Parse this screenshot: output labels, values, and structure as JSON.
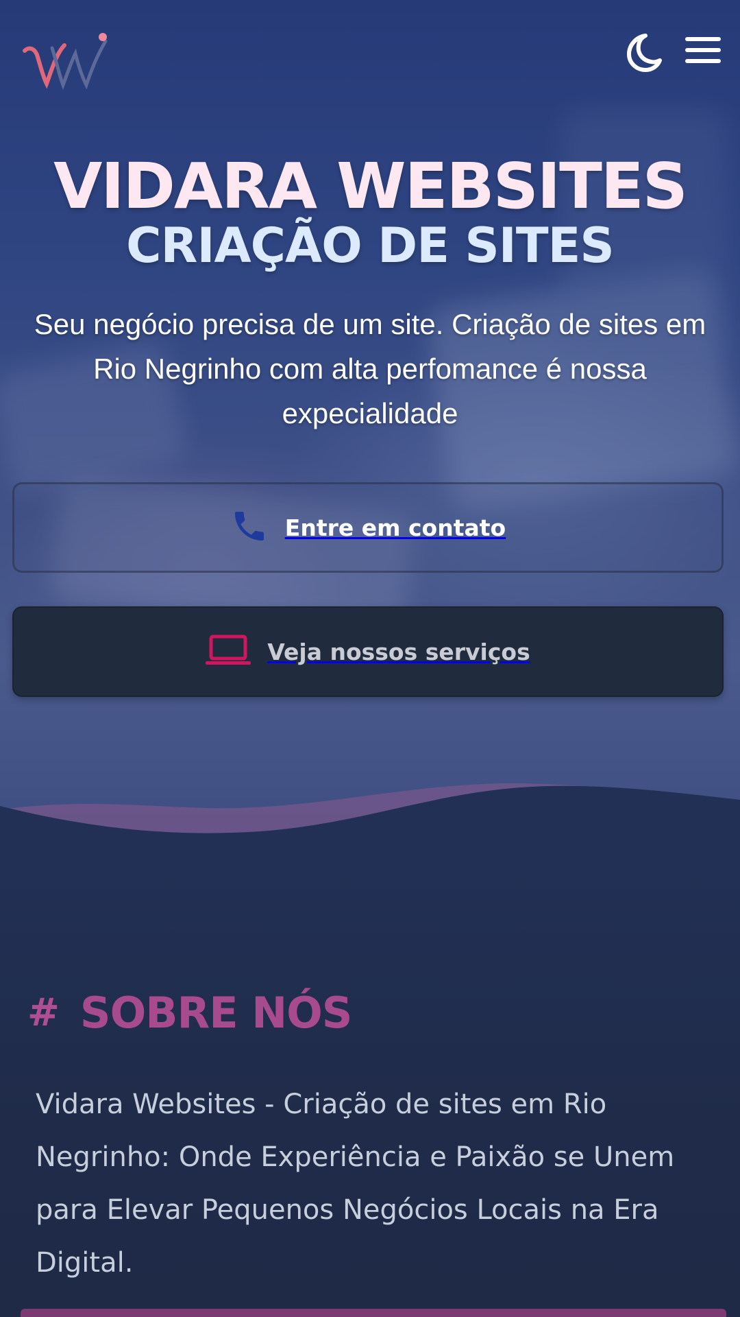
{
  "header": {
    "logo_alt": "VW",
    "theme_toggle_icon": "moon-icon",
    "menu_icon": "hamburger-menu-icon"
  },
  "hero": {
    "title": "VIDARA WEBSITES",
    "subtitle": "CRIAÇÃO DE SITES",
    "description": "Seu negócio precisa de um site. Criação de sites em Rio Negrinho com alta perfomance é nossa expecialidade"
  },
  "buttons": {
    "contact_label": "Entre em contato",
    "contact_icon": "phone-icon",
    "services_label": "Veja nossos serviços",
    "services_icon": "laptop-icon"
  },
  "about": {
    "hash": "#",
    "title": "SOBRE NÓS",
    "text": "Vidara Websites - Criação de sites em Rio Negrinho: Onde Experiência e Paixão se Unem para Elevar Pequenos Negócios Locais na Era Digital."
  },
  "colors": {
    "hero_top": "#263a78",
    "title": "#fde8f2",
    "subtitle": "#dbeafe",
    "accent_pink": "#a84a8e",
    "phone_icon": "#1e3a9c",
    "laptop_icon": "#d0165f",
    "services_button_bg": "#212b3e",
    "section_bg": "#1f2b48"
  }
}
